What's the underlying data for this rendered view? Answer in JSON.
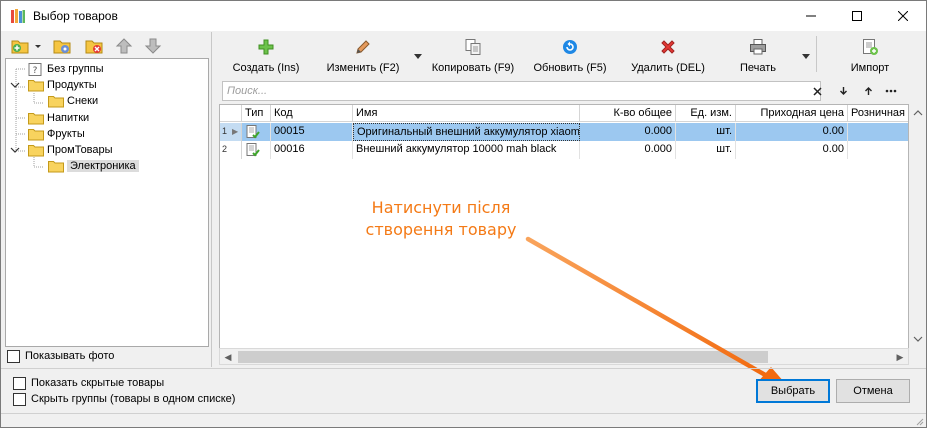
{
  "window": {
    "title": "Выбор товаров",
    "controls": [
      "minimize-icon",
      "maximize-icon",
      "close-icon"
    ]
  },
  "left_toolbar": {
    "icons": [
      "add-group-icon",
      "dropdown-arrow-icon",
      "edit-group-icon",
      "delete-group-icon",
      "move-up-icon",
      "move-down-icon"
    ]
  },
  "tree": {
    "items": [
      {
        "label": "Без группы",
        "level": 0,
        "expanded": null,
        "selected": false
      },
      {
        "label": "Продукты",
        "level": 0,
        "expanded": true,
        "selected": false
      },
      {
        "label": "Снеки",
        "level": 1,
        "expanded": null,
        "selected": false
      },
      {
        "label": "Напитки",
        "level": 0,
        "expanded": null,
        "selected": false
      },
      {
        "label": "Фрукты",
        "level": 0,
        "expanded": null,
        "selected": false
      },
      {
        "label": "ПромТовары",
        "level": 0,
        "expanded": true,
        "selected": false
      },
      {
        "label": "Электроника",
        "level": 1,
        "expanded": null,
        "selected": true
      }
    ],
    "show_photo_label": "Показывать фото",
    "show_photo_checked": false
  },
  "toolbar": {
    "create": "Создать (Ins)",
    "edit": "Изменить (F2)",
    "copy": "Копировать (F9)",
    "refresh": "Обновить (F5)",
    "delete": "Удалить (DEL)",
    "print": "Печать",
    "import": "Импорт"
  },
  "search": {
    "placeholder": "Поиск...",
    "value": ""
  },
  "grid": {
    "columns": [
      "Тип",
      "Код",
      "Имя",
      "К-во общее",
      "Ед. изм.",
      "Приходная цена",
      "Розничная цена"
    ],
    "rows": [
      {
        "num": "1",
        "code": "00015",
        "name": "Оригинальный внешний аккумулятор xiaomi",
        "qty": "0.000",
        "unit": "шт.",
        "purchase_price": "0.00",
        "selected": true
      },
      {
        "num": "2",
        "code": "00016",
        "name": "Внешний аккумулятор 10000 mah black",
        "qty": "0.000",
        "unit": "шт.",
        "purchase_price": "0.00",
        "selected": false
      }
    ]
  },
  "annotation": {
    "line1": "Натиснути після",
    "line2": "створення товару",
    "color": "#f47a16"
  },
  "bottom": {
    "show_hidden_label": "Показать скрытые товары",
    "hide_groups_label": "Скрыть группы (товары в одном списке)",
    "select_button": "Выбрать",
    "cancel_button": "Отмена"
  }
}
